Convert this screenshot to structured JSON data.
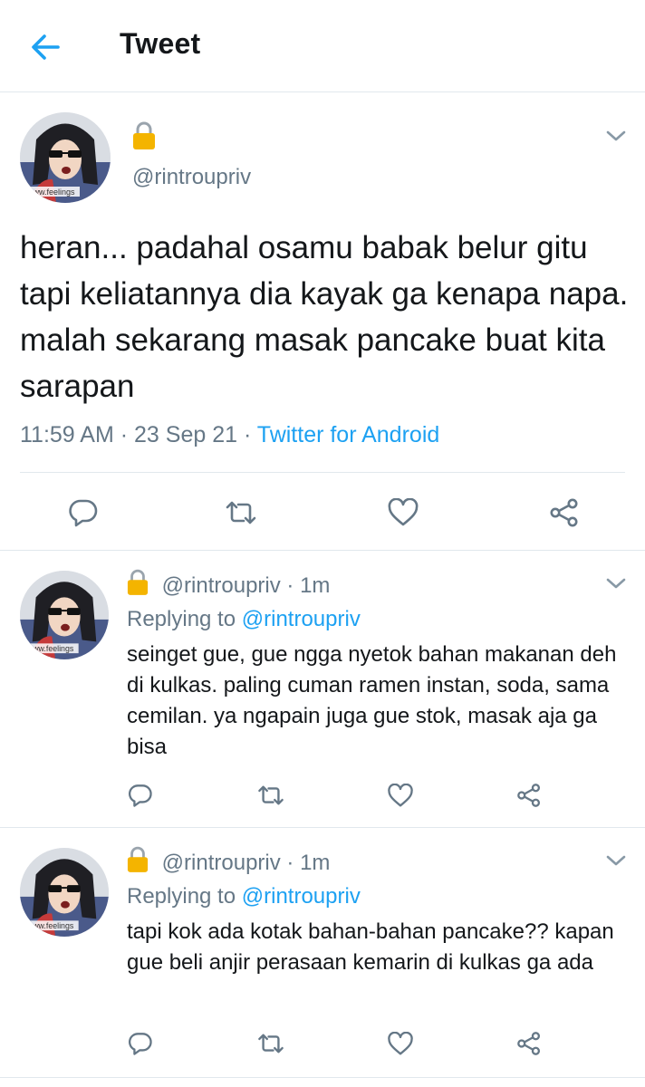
{
  "header": {
    "title": "Tweet"
  },
  "main_tweet": {
    "handle": "@rintroupriv",
    "text": "heran... padahal osamu babak belur gitu tapi keliatannya dia kayak ga kenapa napa. malah sekarang masak pancake buat kita sarapan",
    "time": "11:59 AM",
    "separator": "·",
    "date": "23 Sep 21",
    "source": "Twitter for Android"
  },
  "replies": [
    {
      "handle": "@rintroupriv",
      "age": "1m",
      "separator": "·",
      "replying_label": "Replying to",
      "replying_to": "@rintroupriv",
      "text": "seinget gue, gue ngga nyetok bahan makanan deh di kulkas. paling cuman ramen instan, soda, sama cemilan. ya ngapain juga gue stok, masak aja ga bisa"
    },
    {
      "handle": "@rintroupriv",
      "age": "1m",
      "separator": "·",
      "replying_label": "Replying to",
      "replying_to": "@rintroupriv",
      "text": "tapi kok ada kotak bahan-bahan pancake?? kapan gue beli anjir perasaan kemarin di kulkas ga ada"
    }
  ],
  "avatar": {
    "watermark": "www.feelings"
  },
  "icons": {
    "back": "arrow-left-icon",
    "lock": "lock-icon",
    "chevron": "chevron-down-icon",
    "reply": "reply-icon",
    "retweet": "retweet-icon",
    "like": "heart-icon",
    "share": "share-icon"
  },
  "colors": {
    "accent": "#1da1f2",
    "secondary_text": "#657786",
    "icon_gray": "#657786",
    "divider": "#e1e8ed",
    "lock_gold": "#f4b400"
  }
}
